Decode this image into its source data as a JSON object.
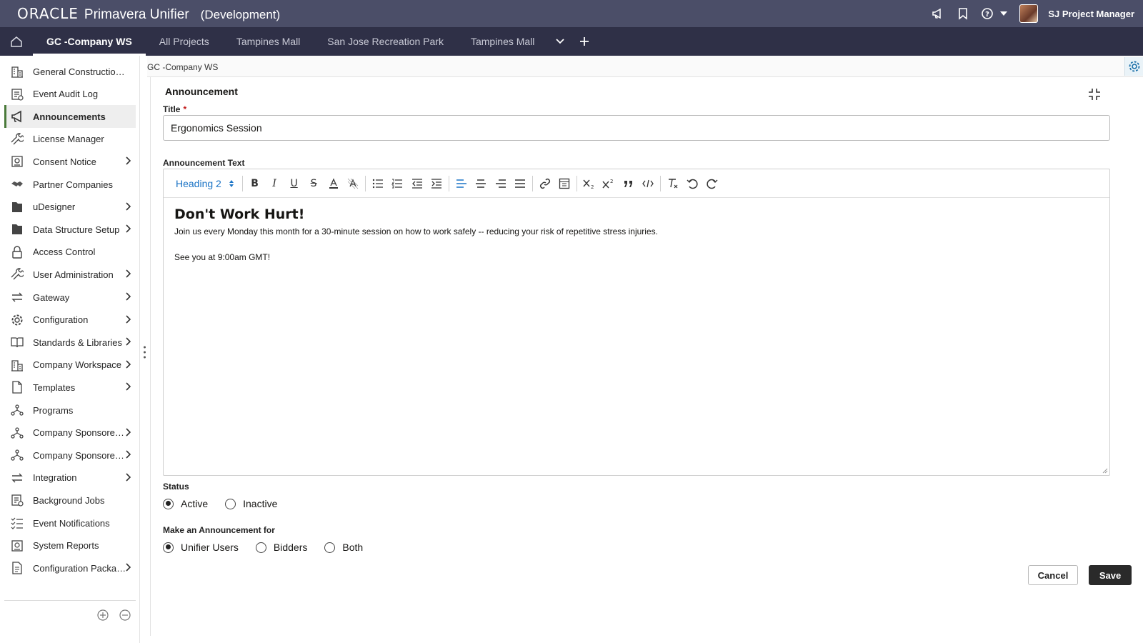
{
  "header": {
    "brand_oracle": "ORACLE",
    "brand_product": "Primavera Unifier",
    "environment": "(Development)",
    "user_name": "SJ Project Manager"
  },
  "tabs": [
    {
      "label": "GC -Company WS",
      "active": true
    },
    {
      "label": "All Projects"
    },
    {
      "label": "Tampines Mall"
    },
    {
      "label": "San Jose Recreation Park"
    },
    {
      "label": "Tampines Mall"
    }
  ],
  "sidebar": {
    "items": [
      {
        "label": "General Construction...",
        "icon": "building-icon"
      },
      {
        "label": "Event Audit Log",
        "icon": "audit-log-icon"
      },
      {
        "label": "Announcements",
        "icon": "megaphone-icon",
        "active": true
      },
      {
        "label": "License Manager",
        "icon": "wrench-icon"
      },
      {
        "label": "Consent Notice",
        "icon": "consent-icon",
        "expandable": true
      },
      {
        "label": "Partner Companies",
        "icon": "handshake-icon"
      },
      {
        "label": "uDesigner",
        "icon": "folder-icon",
        "expandable": true
      },
      {
        "label": "Data Structure Setup",
        "icon": "folder-icon",
        "expandable": true
      },
      {
        "label": "Access Control",
        "icon": "lock-icon"
      },
      {
        "label": "User Administration",
        "icon": "wrench-icon",
        "expandable": true
      },
      {
        "label": "Gateway",
        "icon": "transfer-icon",
        "expandable": true
      },
      {
        "label": "Configuration",
        "icon": "gear-icon",
        "expandable": true
      },
      {
        "label": "Standards & Libraries",
        "icon": "book-icon",
        "expandable": true
      },
      {
        "label": "Company Workspace",
        "icon": "building-icon",
        "expandable": true
      },
      {
        "label": "Templates",
        "icon": "document-icon",
        "expandable": true
      },
      {
        "label": "Programs",
        "icon": "hierarchy-icon"
      },
      {
        "label": "Company Sponsored ...",
        "icon": "hierarchy-icon",
        "expandable": true
      },
      {
        "label": "Company Sponsored ...",
        "icon": "hierarchy-icon",
        "expandable": true
      },
      {
        "label": "Integration",
        "icon": "transfer-icon",
        "expandable": true
      },
      {
        "label": "Background Jobs",
        "icon": "jobs-icon"
      },
      {
        "label": "Event Notifications",
        "icon": "checklist-icon"
      },
      {
        "label": "System Reports",
        "icon": "report-icon"
      },
      {
        "label": "Configuration Packag...",
        "icon": "package-icon",
        "expandable": true
      }
    ]
  },
  "breadcrumb": "GC -Company WS",
  "form": {
    "section_title": "Announcement",
    "title_label": "Title",
    "required_mark": "*",
    "title_value": "Ergonomics Session",
    "text_label": "Announcement Text",
    "block_format": "Heading 2",
    "content_heading": "Don't Work Hurt!",
    "content_para1": "Join us every Monday this month for a 30-minute session on how to work safely -- reducing your risk of repetitive stress injuries.",
    "content_para2": "See you at 9:00am GMT!",
    "status_label": "Status",
    "status_options": [
      {
        "label": "Active",
        "checked": true
      },
      {
        "label": "Inactive",
        "checked": false
      }
    ],
    "audience_label": "Make an Announcement for",
    "audience_options": [
      {
        "label": "Unifier Users",
        "checked": true
      },
      {
        "label": "Bidders",
        "checked": false
      },
      {
        "label": "Both",
        "checked": false
      }
    ],
    "cancel_label": "Cancel",
    "save_label": "Save"
  },
  "colors": {
    "topbar": "#4b4e68",
    "tabbar": "#2f3047",
    "accent": "#1a73c5",
    "save_button": "#2a2a2a"
  }
}
